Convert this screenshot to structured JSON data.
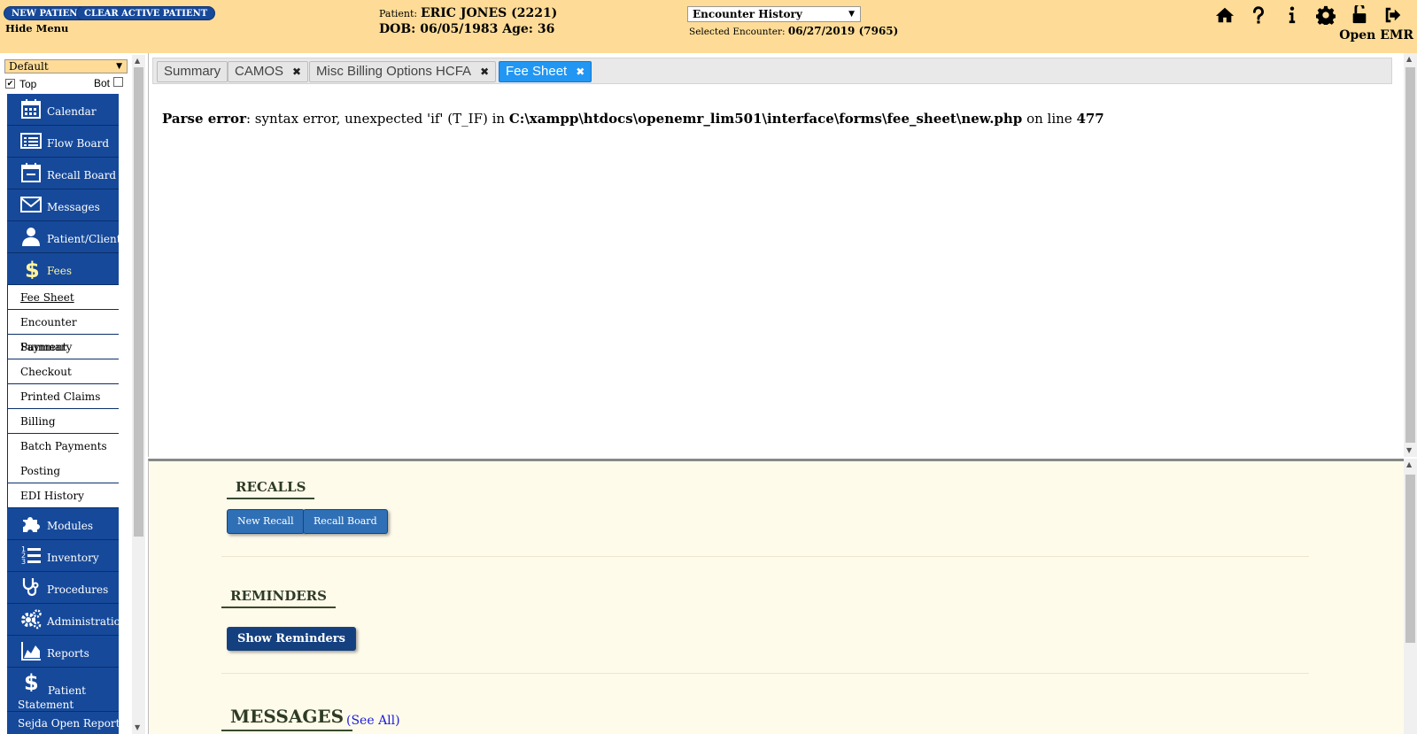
{
  "header": {
    "new_patient_label": "NEW PATIENT",
    "clear_patient_label": "CLEAR ACTIVE PATIENT",
    "hide_menu_label": "Hide Menu",
    "patient_label": "Patient:",
    "patient_name": "ERIC JONES (2221)",
    "dob_line": "DOB: 06/05/1983 Age: 36",
    "encounter_select_value": "Encounter History",
    "selected_encounter_label": "Selected Encounter:",
    "selected_encounter_value": "06/27/2019 (7965)",
    "app_name": "Open EMR",
    "icons": [
      "home-icon",
      "help-icon",
      "info-icon",
      "gear-icon",
      "unlock-icon",
      "logout-icon"
    ]
  },
  "nav": {
    "select_value": "Default",
    "top_label": "Top",
    "bot_label": "Bot",
    "items_before": [
      {
        "label": "Calendar",
        "icon": "calendar-icon"
      },
      {
        "label": "Flow Board",
        "icon": "list-icon"
      },
      {
        "label": "Recall Board",
        "icon": "calendar-minus-icon"
      },
      {
        "label": "Messages",
        "icon": "envelope-icon"
      },
      {
        "label": "Patient/Client",
        "icon": "user-icon"
      },
      {
        "label": "Fees",
        "icon": "dollar-icon"
      }
    ],
    "fees_sub": [
      "Fee Sheet",
      "Encounter Summary",
      "Payment",
      "Checkout",
      "Printed Claims",
      "Billing",
      "Batch Payments",
      "Posting",
      "EDI History"
    ],
    "items_after": [
      {
        "label": "Modules",
        "icon": "puzzle-icon"
      },
      {
        "label": "Inventory",
        "icon": "numbered-list-icon"
      },
      {
        "label": "Procedures",
        "icon": "stethoscope-icon"
      },
      {
        "label": "Administration",
        "icon": "gears-icon"
      },
      {
        "label": "Reports",
        "icon": "area-chart-icon"
      },
      {
        "label": "Patient Statement",
        "icon": "dollar-icon"
      },
      {
        "label": "Sejda Open Reports",
        "icon": ""
      }
    ]
  },
  "tabs": [
    {
      "label": "Summary",
      "closable": false
    },
    {
      "label": "CAMOS",
      "closable": true
    },
    {
      "label": "Misc Billing Options HCFA",
      "closable": true
    },
    {
      "label": "Fee Sheet",
      "closable": true,
      "active": true
    }
  ],
  "error": {
    "prefix": "Parse error",
    "text1": ": syntax error, unexpected 'if' (T_IF) in ",
    "path": "C:\\xampp\\htdocs\\openemr_lim501\\interface\\forms\\fee_sheet\\new.php",
    "text2": " on line ",
    "line": "477"
  },
  "bottom": {
    "recalls_title": "RECALLS",
    "new_recall_label": "New Recall",
    "recall_board_label": "Recall Board",
    "reminders_title": "REMINDERS",
    "show_reminders_label": "Show Reminders",
    "messages_title": "MESSAGES",
    "see_all_label": "(See All)"
  },
  "colors": {
    "header_bg": "#fedc97",
    "menu_blue": "#16499a",
    "active_tab": "#2196f3",
    "bottom_bg": "#fffbeb"
  }
}
